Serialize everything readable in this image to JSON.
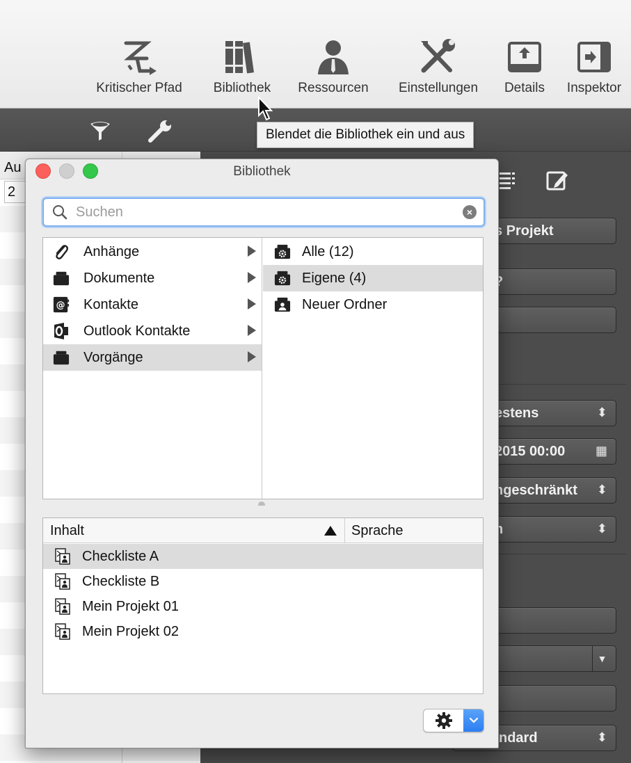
{
  "toolbar": {
    "items": [
      {
        "label": "Kritischer Pfad",
        "icon": "critical-path-icon"
      },
      {
        "label": "Bibliothek",
        "icon": "library-books-icon"
      },
      {
        "label": "Ressourcen",
        "icon": "resources-person-icon"
      },
      {
        "label": "Einstellungen",
        "icon": "tools-icon"
      },
      {
        "label": "Details",
        "icon": "details-upload-icon"
      },
      {
        "label": "Inspektor",
        "icon": "inspector-icon"
      }
    ]
  },
  "tooltip": "Blendet die Bibliothek ein und aus",
  "background": {
    "left_header": "Au",
    "left_cell": "2",
    "right_fields": [
      {
        "text": "s Projekt"
      },
      {
        "text": "?"
      },
      {
        "text": ""
      },
      {
        "text": "estens",
        "arrow": "⬍"
      },
      {
        "text": "2015 00:00",
        "arrow": "▦"
      },
      {
        "text": "ngeschränkt",
        "arrow": "⬍"
      },
      {
        "text": "h",
        "arrow": "⬍"
      },
      {
        "text": ""
      },
      {
        "text": "",
        "arrow": "▼"
      },
      {
        "text": ""
      },
      {
        "text": "ndard",
        "arrow": "⬍"
      }
    ]
  },
  "window": {
    "title": "Bibliothek",
    "search": {
      "placeholder": "Suchen",
      "value": ""
    },
    "categories": [
      {
        "label": "Anhänge",
        "icon": "paperclip-icon"
      },
      {
        "label": "Dokumente",
        "icon": "folder-icon"
      },
      {
        "label": "Kontakte",
        "icon": "contacts-at-icon"
      },
      {
        "label": "Outlook Kontakte",
        "icon": "outlook-icon"
      },
      {
        "label": "Vorgänge",
        "icon": "folder-icon",
        "selected": true
      }
    ],
    "folders": [
      {
        "label": "Alle (12)",
        "icon": "gear-folder-icon"
      },
      {
        "label": "Eigene (4)",
        "icon": "gear-folder-icon",
        "selected": true
      },
      {
        "label": "Neuer Ordner",
        "icon": "person-folder-icon"
      }
    ],
    "content": {
      "col_inhalt": "Inhalt",
      "col_sprache": "Sprache",
      "rows": [
        {
          "label": "Checkliste A",
          "selected": true
        },
        {
          "label": "Checkliste B"
        },
        {
          "label": "Mein Projekt 01"
        },
        {
          "label": "Mein Projekt 02"
        }
      ]
    }
  },
  "colors": {
    "accent": "#2c7ef1",
    "close": "#fc605c",
    "minimize": "#cfcfcf",
    "zoom": "#34c84a"
  }
}
